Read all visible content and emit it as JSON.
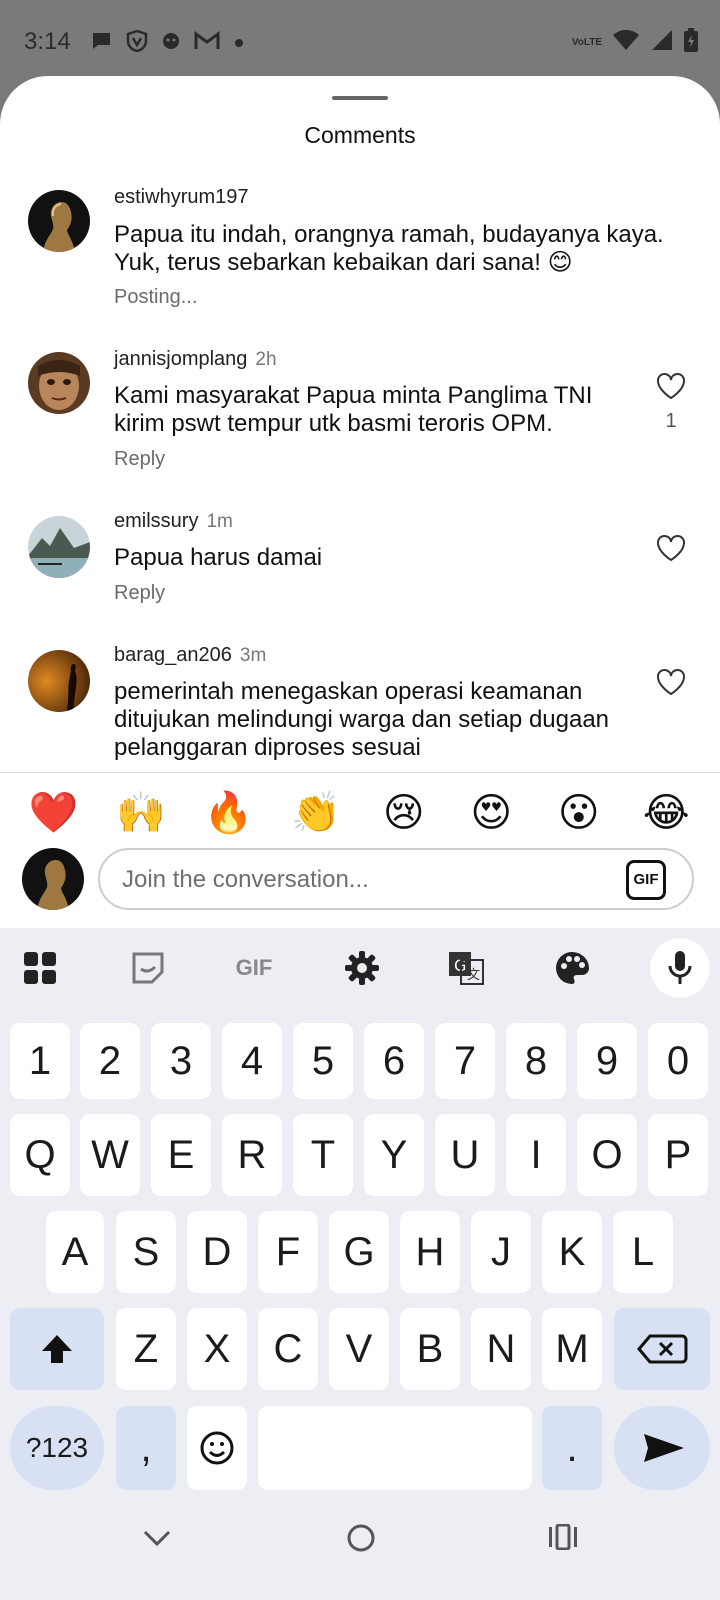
{
  "status_bar": {
    "time": "3:14",
    "network_label": "VoLTE",
    "icons": [
      "chat-icon",
      "shield-icon",
      "face-icon",
      "gmail-icon",
      "dot-icon",
      "wifi-icon",
      "signal-icon",
      "battery-icon"
    ]
  },
  "sheet": {
    "title": "Comments"
  },
  "comments": [
    {
      "username": "estiwhyrum197",
      "time": "",
      "text": "Papua itu indah, orangnya ramah, budayanya kaya. Yuk, terus sebarkan kebaikan dari sana! 😊",
      "sub": "Posting...",
      "likes": ""
    },
    {
      "username": "jannisjomplang",
      "time": "2h",
      "text": "Kami masyarakat Papua minta Panglima TNI kirim pswt tempur utk basmi teroris OPM.",
      "sub": "Reply",
      "likes": "1"
    },
    {
      "username": "emilssury",
      "time": "1m",
      "text": "Papua harus damai",
      "sub": "Reply",
      "likes": ""
    },
    {
      "username": "barag_an206",
      "time": "3m",
      "text": "pemerintah menegaskan operasi keamanan ditujukan melindungi warga dan setiap dugaan pelanggaran diproses sesuai",
      "sub": "",
      "likes": ""
    }
  ],
  "emoji_bar": [
    "❤️",
    "🙌",
    "🔥",
    "👏",
    "😢",
    "😍",
    "😮",
    "😂"
  ],
  "compose": {
    "placeholder": "Join the conversation...",
    "gif_label": "GIF"
  },
  "keyboard": {
    "toolbar_gif": "GIF",
    "row_numbers": [
      "1",
      "2",
      "3",
      "4",
      "5",
      "6",
      "7",
      "8",
      "9",
      "0"
    ],
    "row1": [
      "Q",
      "W",
      "E",
      "R",
      "T",
      "Y",
      "U",
      "I",
      "O",
      "P"
    ],
    "row2": [
      "A",
      "S",
      "D",
      "F",
      "G",
      "H",
      "J",
      "K",
      "L"
    ],
    "row3": [
      "Z",
      "X",
      "C",
      "V",
      "B",
      "N",
      "M"
    ],
    "symbols": "?123",
    "comma": ",",
    "period": "."
  },
  "colors": {
    "sheet_bg": "#ffffff",
    "keyboard_bg": "#eceef4",
    "special_key_bg": "#d7e1f3",
    "heart": "#e0202e"
  }
}
